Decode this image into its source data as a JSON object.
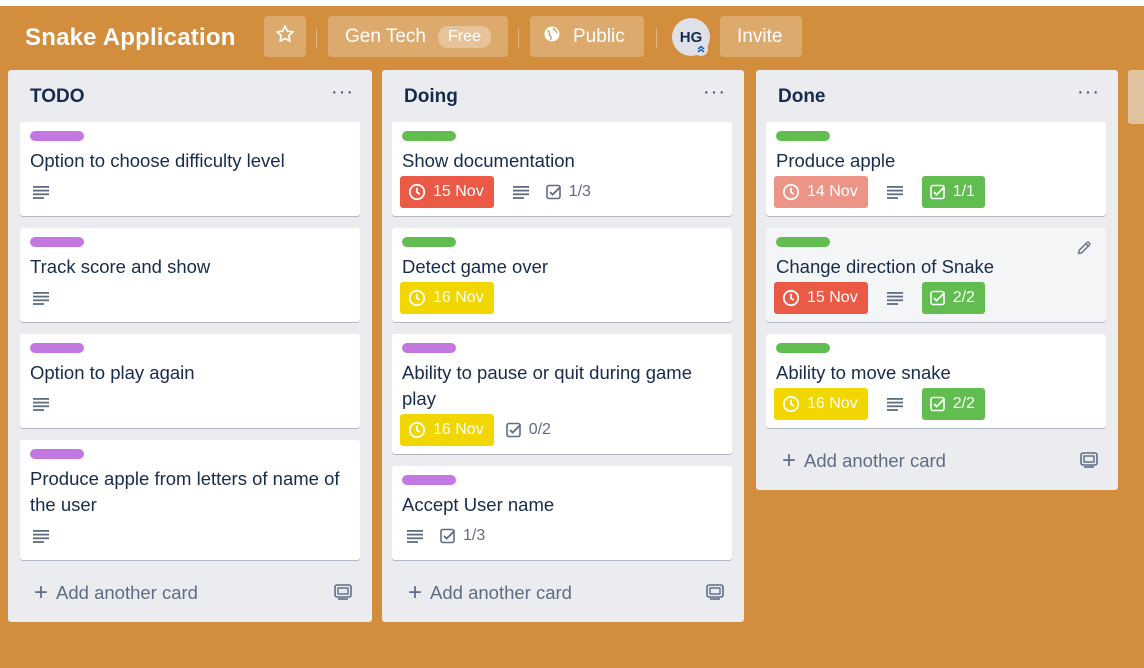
{
  "board": {
    "title": "Snake Application",
    "team": "Gen Tech",
    "team_plan": "Free",
    "visibility": "Public",
    "member_initials": "HG",
    "invite_label": "Invite"
  },
  "icons": {
    "star": "star-icon",
    "globe": "globe-icon",
    "menu": "more-icon",
    "description": "description-icon",
    "clock": "clock-icon",
    "checklist": "checklist-icon",
    "edit": "pencil-icon",
    "template": "card-template-icon",
    "add": "plus-icon"
  },
  "colors": {
    "board_bg": "#d28e3c",
    "label_purple": "#c377e0",
    "label_green": "#61bd4f",
    "due_overdue": "#eb5a46",
    "due_past": "#ec9488",
    "due_soon": "#f2d600",
    "checklist_complete": "#61bd4f"
  },
  "add_card_label": "Add another card",
  "lists": [
    {
      "title": "TODO",
      "cards": [
        {
          "label": "purple",
          "title": "Option to choose difficulty level",
          "description": true
        },
        {
          "label": "purple",
          "title": "Track score and show",
          "description": true
        },
        {
          "label": "purple",
          "title": "Option to play again",
          "description": true
        },
        {
          "label": "purple",
          "title": "Produce apple from letters of name of the user",
          "description": true
        }
      ]
    },
    {
      "title": "Doing",
      "cards": [
        {
          "label": "green",
          "title": "Show documentation",
          "due": "15 Nov",
          "due_status": "overdue",
          "description": true,
          "checklist": "1/3"
        },
        {
          "label": "green",
          "title": "Detect game over",
          "due": "16 Nov",
          "due_status": "soon"
        },
        {
          "label": "purple",
          "title": "Ability to pause or quit during game play",
          "due": "16 Nov",
          "due_status": "soon",
          "checklist": "0/2"
        },
        {
          "label": "purple",
          "title": "Accept User name",
          "description": true,
          "checklist": "1/3"
        }
      ]
    },
    {
      "title": "Done",
      "cards": [
        {
          "label": "green",
          "title": "Produce apple",
          "due": "14 Nov",
          "due_status": "past",
          "description": true,
          "checklist": "1/1",
          "checklist_complete": true
        },
        {
          "label": "green",
          "title": "Change direction of Snake",
          "due": "15 Nov",
          "due_status": "overdue",
          "description": true,
          "checklist": "2/2",
          "checklist_complete": true,
          "hovered": true
        },
        {
          "label": "green",
          "title": "Ability to move snake",
          "due": "16 Nov",
          "due_status": "soon",
          "description": true,
          "checklist": "2/2",
          "checklist_complete": true
        }
      ]
    }
  ]
}
